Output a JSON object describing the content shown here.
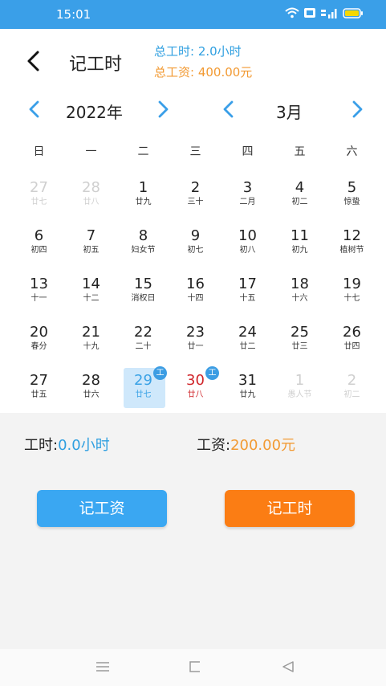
{
  "status_bar": {
    "time": "15:01",
    "icons": [
      "wifi-icon",
      "hd-icon",
      "signal-icon",
      "battery-icon"
    ]
  },
  "header": {
    "title": "记工时",
    "summary_hours": "总工时: 2.0小时",
    "summary_wage": "总工资: 400.00元"
  },
  "nav": {
    "year": "2022年",
    "month": "3月"
  },
  "weekdays": [
    "日",
    "一",
    "二",
    "三",
    "四",
    "五",
    "六"
  ],
  "calendar": [
    {
      "day": "27",
      "lunar": "廿七",
      "state": "faded"
    },
    {
      "day": "28",
      "lunar": "廿八",
      "state": "faded"
    },
    {
      "day": "1",
      "lunar": "廿九",
      "state": "normal"
    },
    {
      "day": "2",
      "lunar": "三十",
      "state": "normal"
    },
    {
      "day": "3",
      "lunar": "二月",
      "state": "normal"
    },
    {
      "day": "4",
      "lunar": "初二",
      "state": "normal"
    },
    {
      "day": "5",
      "lunar": "惊蛰",
      "state": "normal"
    },
    {
      "day": "6",
      "lunar": "初四",
      "state": "normal"
    },
    {
      "day": "7",
      "lunar": "初五",
      "state": "normal"
    },
    {
      "day": "8",
      "lunar": "妇女节",
      "state": "normal"
    },
    {
      "day": "9",
      "lunar": "初七",
      "state": "normal"
    },
    {
      "day": "10",
      "lunar": "初八",
      "state": "normal"
    },
    {
      "day": "11",
      "lunar": "初九",
      "state": "normal"
    },
    {
      "day": "12",
      "lunar": "植树节",
      "state": "normal"
    },
    {
      "day": "13",
      "lunar": "十一",
      "state": "normal"
    },
    {
      "day": "14",
      "lunar": "十二",
      "state": "normal"
    },
    {
      "day": "15",
      "lunar": "消权日",
      "state": "normal"
    },
    {
      "day": "16",
      "lunar": "十四",
      "state": "normal"
    },
    {
      "day": "17",
      "lunar": "十五",
      "state": "normal"
    },
    {
      "day": "18",
      "lunar": "十六",
      "state": "normal"
    },
    {
      "day": "19",
      "lunar": "十七",
      "state": "normal"
    },
    {
      "day": "20",
      "lunar": "春分",
      "state": "normal"
    },
    {
      "day": "21",
      "lunar": "十九",
      "state": "normal"
    },
    {
      "day": "22",
      "lunar": "二十",
      "state": "normal"
    },
    {
      "day": "23",
      "lunar": "廿一",
      "state": "normal"
    },
    {
      "day": "24",
      "lunar": "廿二",
      "state": "normal"
    },
    {
      "day": "25",
      "lunar": "廿三",
      "state": "normal"
    },
    {
      "day": "26",
      "lunar": "廿四",
      "state": "normal"
    },
    {
      "day": "27",
      "lunar": "廿五",
      "state": "normal"
    },
    {
      "day": "28",
      "lunar": "廿六",
      "state": "normal"
    },
    {
      "day": "29",
      "lunar": "廿七",
      "state": "selected",
      "badge": "工"
    },
    {
      "day": "30",
      "lunar": "廿八",
      "state": "red",
      "badge": "工"
    },
    {
      "day": "31",
      "lunar": "廿九",
      "state": "normal"
    },
    {
      "day": "1",
      "lunar": "愚人节",
      "state": "faded"
    },
    {
      "day": "2",
      "lunar": "初二",
      "state": "faded"
    }
  ],
  "stats": {
    "hours_label": "工时:",
    "hours_value": "0.0小时",
    "wage_label": "工资:",
    "wage_value": "200.00元"
  },
  "buttons": {
    "record_wage": "记工资",
    "record_hours": "记工时"
  },
  "navbar": [
    "menu-icon",
    "home-icon",
    "back-triangle-icon"
  ],
  "colors": {
    "accent": "#3a9fe8",
    "orange": "#fb7d14",
    "red": "#d0262b"
  }
}
